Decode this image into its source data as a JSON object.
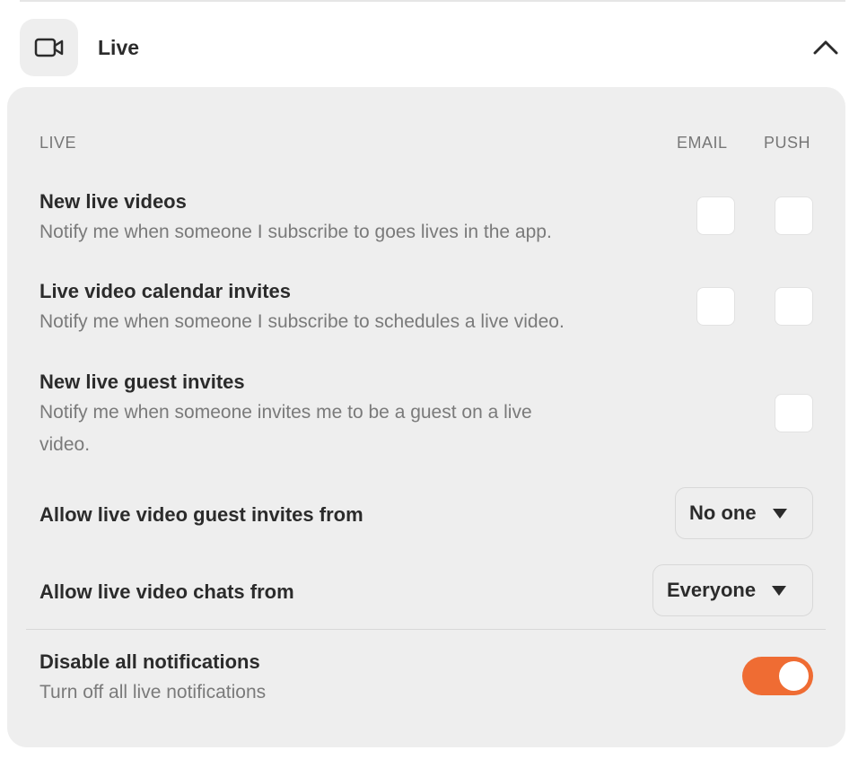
{
  "header": {
    "icon": "video-camera-icon",
    "title": "Live",
    "collapse_icon": "chevron-up-icon"
  },
  "panel": {
    "section_label": "LIVE",
    "columns": {
      "email": "EMAIL",
      "push": "PUSH"
    },
    "rows": [
      {
        "title": "New live videos",
        "desc": "Notify me when someone I subscribe to goes lives in the app.",
        "email_checked": false,
        "push_checked": false
      },
      {
        "title": "Live video calendar invites",
        "desc": "Notify me when someone I subscribe to schedules a live video.",
        "email_checked": false,
        "push_checked": false
      },
      {
        "title": "New live guest invites",
        "desc_line1": "Notify me when someone invites me to be a guest on a live",
        "desc_line2": "video.",
        "push_checked": false
      }
    ],
    "guest_invites": {
      "label": "Allow live video guest invites from",
      "value": "No one"
    },
    "chats": {
      "label": "Allow live video chats from",
      "value": "Everyone"
    },
    "disable_all": {
      "title": "Disable all notifications",
      "desc": "Turn off all live notifications",
      "enabled": true,
      "accent": "#ef6c33"
    }
  }
}
